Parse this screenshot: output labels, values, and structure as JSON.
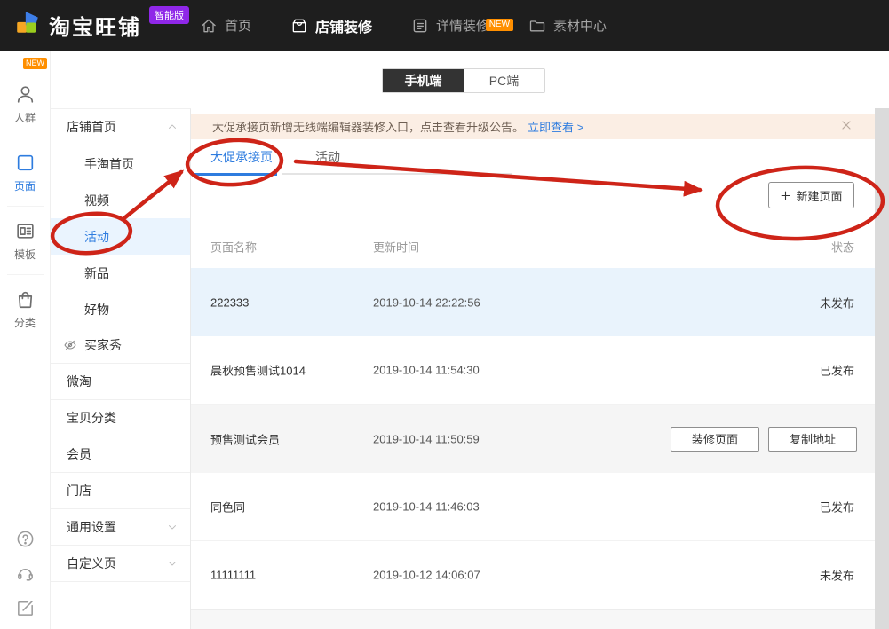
{
  "header": {
    "logo_text": "淘宝旺铺",
    "logo_badge": "智能版",
    "nav": [
      {
        "label": "首页",
        "icon": "home",
        "active": false,
        "badge": null
      },
      {
        "label": "店铺装修",
        "icon": "shop",
        "active": true,
        "badge": null
      },
      {
        "label": "详情装修",
        "icon": "detail",
        "active": false,
        "badge": "NEW"
      },
      {
        "label": "素材中心",
        "icon": "folder",
        "active": false,
        "badge": null
      }
    ]
  },
  "rail": {
    "new_badge": "NEW",
    "items": [
      {
        "label": "人群",
        "icon": "person",
        "active": false
      },
      {
        "label": "页面",
        "icon": "page",
        "active": true
      },
      {
        "label": "模板",
        "icon": "template",
        "active": false
      },
      {
        "label": "分类",
        "icon": "bag",
        "active": false
      }
    ],
    "footer_icons": [
      "help",
      "headset",
      "feedback"
    ]
  },
  "sidebar": {
    "items": [
      {
        "label": "店铺首页",
        "level": "group",
        "chevron": "up",
        "divider": true,
        "active": false,
        "icon": null
      },
      {
        "label": "手淘首页",
        "level": "sub",
        "chevron": null,
        "divider": false,
        "active": false,
        "icon": null
      },
      {
        "label": "视频",
        "level": "sub",
        "chevron": null,
        "divider": false,
        "active": false,
        "icon": null
      },
      {
        "label": "活动",
        "level": "sub",
        "chevron": null,
        "divider": false,
        "active": true,
        "icon": null
      },
      {
        "label": "新品",
        "level": "sub",
        "chevron": null,
        "divider": false,
        "active": false,
        "icon": null
      },
      {
        "label": "好物",
        "level": "sub",
        "chevron": null,
        "divider": false,
        "active": false,
        "icon": null
      },
      {
        "label": "买家秀",
        "level": "sub",
        "chevron": null,
        "divider": true,
        "active": false,
        "icon": "eye-off"
      },
      {
        "label": "微淘",
        "level": "top",
        "chevron": null,
        "divider": true,
        "active": false,
        "icon": null
      },
      {
        "label": "宝贝分类",
        "level": "top",
        "chevron": null,
        "divider": true,
        "active": false,
        "icon": null
      },
      {
        "label": "会员",
        "level": "top",
        "chevron": null,
        "divider": true,
        "active": false,
        "icon": null
      },
      {
        "label": "门店",
        "level": "top",
        "chevron": null,
        "divider": true,
        "active": false,
        "icon": null
      },
      {
        "label": "通用设置",
        "level": "top",
        "chevron": "down",
        "divider": true,
        "active": false,
        "icon": null
      },
      {
        "label": "自定义页",
        "level": "top",
        "chevron": "down",
        "divider": true,
        "active": false,
        "icon": null
      }
    ]
  },
  "toggle": {
    "options": [
      "手机端",
      "PC端"
    ],
    "selected": "手机端"
  },
  "notice": {
    "text": "大促承接页新增无线端编辑器装修入口，点击查看升级公告。",
    "link": "立即查看 >"
  },
  "tabs": [
    {
      "label": "大促承接页",
      "active": true
    },
    {
      "label": "活动",
      "active": false
    }
  ],
  "toolbar": {
    "new_page_label": "新建页面"
  },
  "table": {
    "headers": [
      "页面名称",
      "更新时间",
      "状态"
    ],
    "rows": [
      {
        "name": "222333",
        "time": "2019-10-14 22:22:56",
        "status": "未发布",
        "actions": null,
        "highlight": "blue"
      },
      {
        "name": "晨秋预售测试1014",
        "time": "2019-10-14 11:54:30",
        "status": "已发布",
        "actions": null,
        "highlight": null
      },
      {
        "name": "预售测试会员",
        "time": "2019-10-14 11:50:59",
        "status": null,
        "actions": [
          "装修页面",
          "复制地址"
        ],
        "highlight": "gray"
      },
      {
        "name": "同色同",
        "time": "2019-10-14 11:46:03",
        "status": "已发布",
        "actions": null,
        "highlight": null
      },
      {
        "name": "11111111",
        "time": "2019-10-12 14:06:07",
        "status": "未发布",
        "actions": null,
        "highlight": null
      }
    ]
  },
  "colors": {
    "accent_blue": "#2E7CDF",
    "annotation_red": "#CE2418",
    "header_bg": "#1E1E1E",
    "badge_purple": "#8F27E8",
    "badge_orange": "#FF8F00",
    "notice_bg": "#FBEEE4",
    "row_highlight_blue": "#E9F3FC",
    "row_hover_gray": "#F5F5F5"
  }
}
